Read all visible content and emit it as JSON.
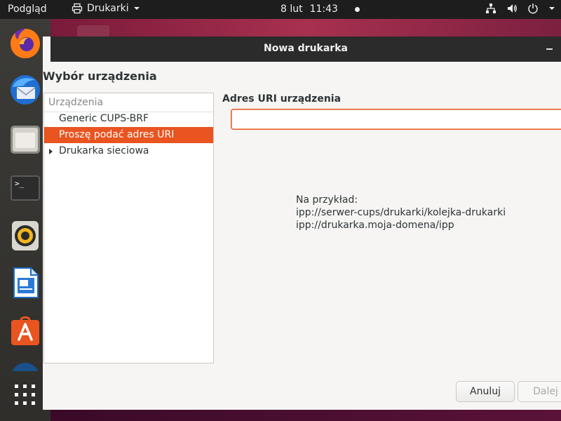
{
  "topbar": {
    "activities": "Podgląd",
    "app_name": "Drukarki",
    "date": "8 lut",
    "time": "11:43",
    "icons": [
      "network-icon",
      "volume-icon",
      "power-icon",
      "chevron-down-icon"
    ]
  },
  "dock": {
    "apps": [
      "firefox-icon",
      "thunderbird-icon",
      "files-icon",
      "terminal-icon",
      "rhythmbox-icon",
      "writer-icon",
      "software-icon",
      "help-icon",
      "app-grid-icon"
    ]
  },
  "window": {
    "title": "Nowa drukarka",
    "heading": "Wybór urządzenia",
    "device_list": {
      "header": "Urządzenia",
      "items": [
        {
          "label": "Generic CUPS-BRF",
          "selected": false,
          "expandable": false
        },
        {
          "label": "Proszę podać adres URI",
          "selected": true,
          "expandable": false
        },
        {
          "label": "Drukarka sieciowa",
          "selected": false,
          "expandable": true
        }
      ]
    },
    "uri": {
      "label": "Adres URI urządzenia",
      "value": ""
    },
    "example": {
      "line1": "Na przykład:",
      "line2": "ipp://serwer-cups/drukarki/kolejka-drukarki",
      "line3": "ipp://drukarka.moja-domena/ipp"
    },
    "buttons": {
      "cancel": "Anuluj",
      "next": "Dalej"
    }
  },
  "colors": {
    "accent": "#e95420",
    "titlebar": "#2b2b2b",
    "topbar": "#1d1d1d",
    "dock": "#3c3b37"
  }
}
